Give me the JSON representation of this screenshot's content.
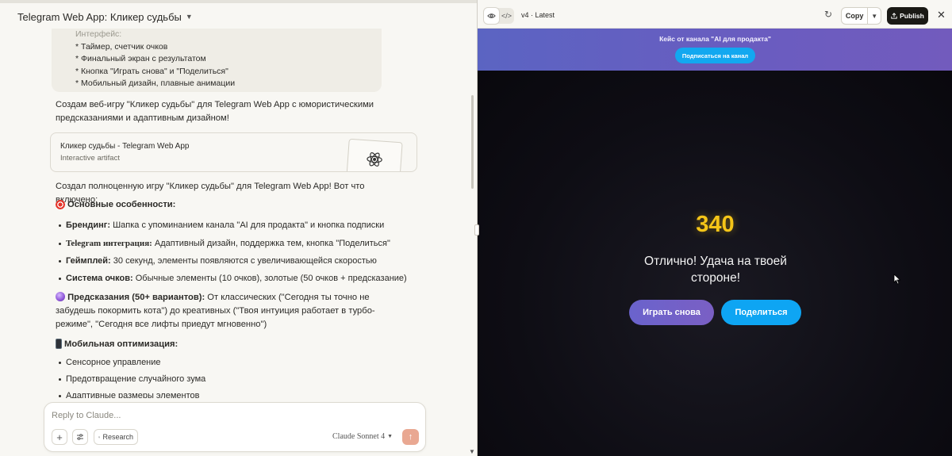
{
  "chat": {
    "title": "Telegram Web App: Кликер судьбы",
    "requirements": {
      "faded_line": "Интерфейс:",
      "lines": [
        "* Таймер, счетчик очков",
        "* Финальный экран с результатом",
        "* Кнопка \"Играть снова\" и \"Поделиться\"",
        "* Мобильный дизайн, плавные анимации"
      ]
    },
    "intro": "Создам веб-игру \"Кликер судьбы\" для Telegram Web App с юмористическими предсказаниями и адаптивным дизайном!",
    "artifact_card": {
      "title": "Кликер судьбы - Telegram Web App",
      "subtitle": "Interactive artifact"
    },
    "summary": "Создал полноценную игру \"Кликер судьбы\" для Telegram Web App! Вот что включено:",
    "section1": {
      "heading": "Основные особенности:",
      "icon": "target-emoji",
      "bullets": [
        {
          "bold": "Брендинг:",
          "text": " Шапка с упоминанием канала \"AI для продакта\" и кнопка подписки"
        },
        {
          "bold": "Telegram интеграция:",
          "text": " Адаптивный дизайн, поддержка тем, кнопка \"Поделиться\""
        },
        {
          "bold": "Геймплей:",
          "text": " 30 секунд, элементы появляются с увеличивающейся скоростью"
        },
        {
          "bold": "Система очков:",
          "text": " Обычные элементы (10 очков), золотые (50 очков + предсказание)"
        }
      ]
    },
    "section2": {
      "icon": "crystal-ball-emoji",
      "bold": "Предсказания (50+ вариантов):",
      "text": " От классических (\"Сегодня ты точно не забудешь покормить кота\") до креативных (\"Твоя интуиция работает в турбо-режиме\", \"Сегодня все лифты приедут мгновенно\")"
    },
    "section3": {
      "heading": "Мобильная оптимизация:",
      "icon": "mobile-phone-emoji",
      "bullets": [
        "Сенсорное управление",
        "Предотвращение случайного зума",
        "Адаптивные размеры элементов"
      ]
    },
    "composer": {
      "placeholder": "Reply to Claude...",
      "research_label": "Research",
      "model": "Claude Sonnet 4"
    }
  },
  "artifact_panel": {
    "version": "v4 · Latest",
    "copy_label": "Copy",
    "publish_label": "Publish"
  },
  "app": {
    "banner_title": "Кейс от канала \"AI для продакта\"",
    "subscribe_label": "Подписаться на канал",
    "score": "340",
    "result_text": "Отлично! Удача на твоей стороне!",
    "play_again_label": "Играть снова",
    "share_label": "Поделиться"
  },
  "colors": {
    "accent_send": "#e9a892",
    "score_gold": "#f5c518",
    "banner_purple": "#6a5cc0",
    "share_blue": "#0ea5f3"
  }
}
